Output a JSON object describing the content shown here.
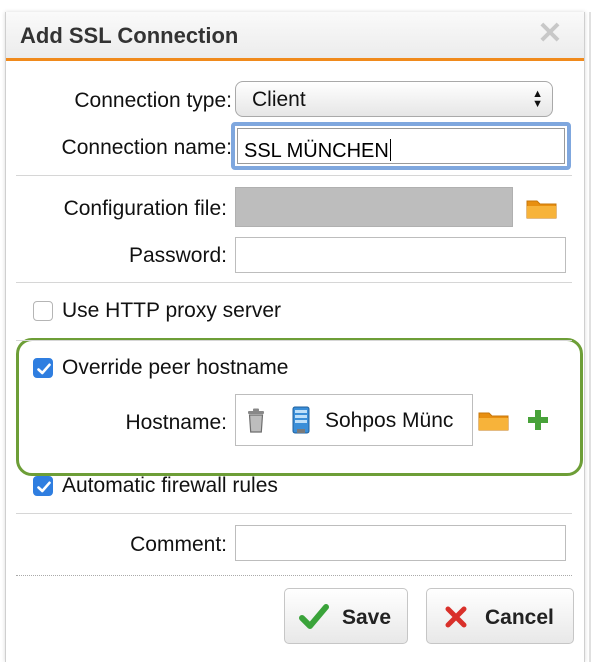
{
  "dialog": {
    "title": "Add SSL Connection",
    "close_icon": "close-x-icon"
  },
  "form": {
    "connection_type": {
      "label": "Connection type:",
      "value": "Client"
    },
    "connection_name": {
      "label": "Connection name:",
      "value": "SSL MÜNCHEN"
    },
    "configuration_file": {
      "label": "Configuration file:",
      "value": ""
    },
    "password": {
      "label": "Password:",
      "value": ""
    },
    "use_http_proxy": {
      "label": "Use HTTP proxy server",
      "checked": false
    },
    "override_peer_hostname": {
      "label": "Override peer hostname",
      "checked": true
    },
    "hostname": {
      "label": "Hostname:",
      "value": "Sohpos Münc"
    },
    "automatic_firewall_rules": {
      "label": "Automatic firewall rules",
      "checked": true
    },
    "comment": {
      "label": "Comment:",
      "value": ""
    }
  },
  "buttons": {
    "save": "Save",
    "cancel": "Cancel"
  },
  "colors": {
    "title_underline": "#f08a1c",
    "focus_ring": "#7fa7de",
    "checkbox_on": "#2f7ee0",
    "highlight_frame": "#6d9e37",
    "save_icon": "#3aa33a",
    "cancel_icon": "#d9302a",
    "add_icon": "#48a23a",
    "folder_icon": "#f2a11a"
  }
}
